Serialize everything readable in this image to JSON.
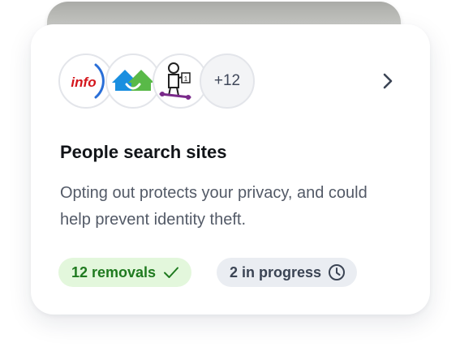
{
  "card": {
    "title": "People search sites",
    "description": "Opting out protects your privacy, and could help prevent identity theft.",
    "more_count": "+12",
    "sites": [
      {
        "name": "info",
        "icon": "info-logo-icon"
      },
      {
        "name": "house",
        "icon": "house-logo-icon"
      },
      {
        "name": "figure",
        "icon": "figure-logo-icon"
      }
    ]
  },
  "badges": {
    "removals_label": "12 removals",
    "removals_icon": "checkmark-icon",
    "progress_label": "2 in progress",
    "progress_icon": "clock-icon"
  },
  "colors": {
    "removals_bg": "#e3f7dc",
    "removals_text": "#1f7a1f",
    "progress_bg": "#eaedf2",
    "progress_text": "#3b4454",
    "info_red": "#d4161c",
    "info_blue": "#2a6fd8",
    "house_blue": "#1a8fe0",
    "house_green": "#59b948"
  }
}
